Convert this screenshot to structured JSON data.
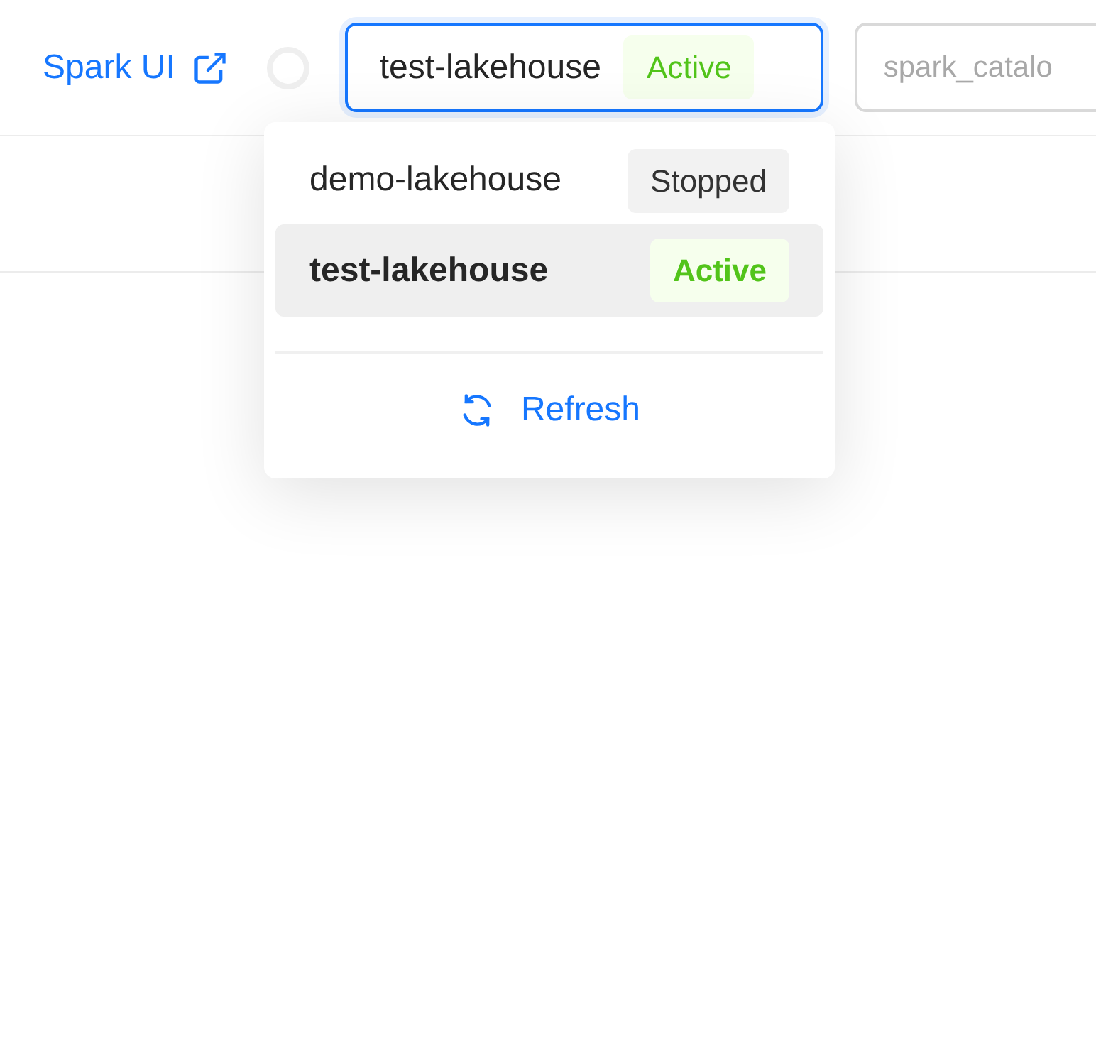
{
  "header": {
    "spark_link": "Spark UI",
    "loading": true,
    "lakehouse_select": {
      "value": "test-lakehouse",
      "status": {
        "kind": "active",
        "label": "Active"
      },
      "open": true
    },
    "catalog_field": {
      "placeholder": "spark_catalo"
    }
  },
  "dropdown": {
    "options": [
      {
        "label": "demo-lakehouse",
        "status": {
          "kind": "stopped",
          "label": "Stopped"
        },
        "selected": false
      },
      {
        "label": "test-lakehouse",
        "status": {
          "kind": "active",
          "label": "Active"
        },
        "selected": true
      }
    ],
    "action": "Refresh"
  }
}
